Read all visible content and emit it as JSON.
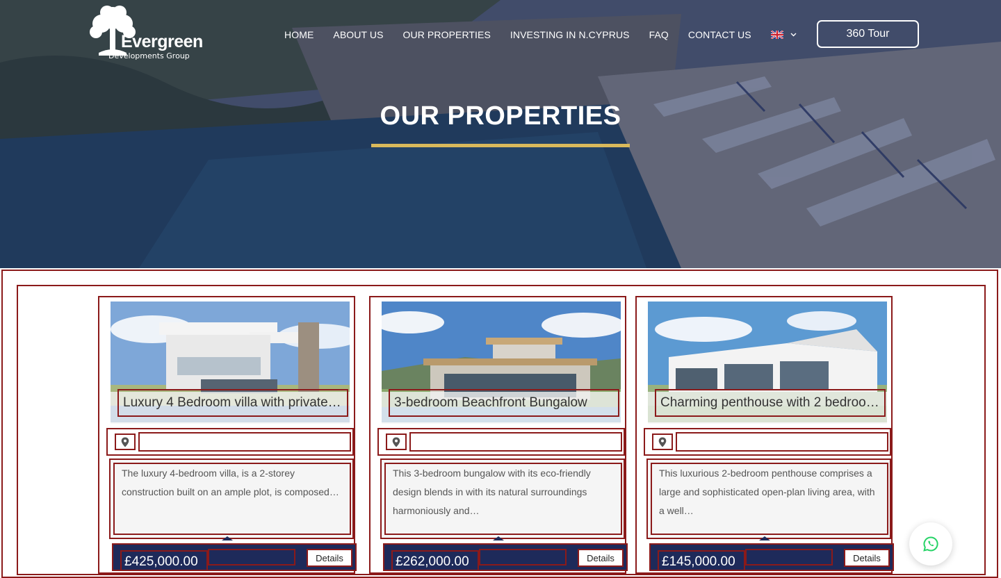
{
  "header": {
    "logo": {
      "name": "Evergreen",
      "subtitle": "Developments Group"
    },
    "nav": [
      {
        "label": "HOME"
      },
      {
        "label": "ABOUT US"
      },
      {
        "label": "OUR PROPERTIES"
      },
      {
        "label": "INVESTING IN N.CYPRUS"
      },
      {
        "label": "FAQ"
      },
      {
        "label": "CONTACT US"
      }
    ],
    "language": {
      "icon": "uk-flag-icon",
      "chevron": "chevron-down-icon"
    },
    "cta": {
      "label": "360 Tour"
    }
  },
  "hero": {
    "title": "OUR PROPERTIES",
    "underline_color": "#d9b95b"
  },
  "properties": [
    {
      "title": "Luxury 4 Bedroom villa with private…",
      "location": "",
      "description": "The luxury 4-bedroom villa, is a 2-storey construction built on an ample plot, is composed…",
      "price": "£425,000.00",
      "details_label": "Details"
    },
    {
      "title": "3-bedroom Beachfront Bungalow",
      "location": "",
      "description": "This 3-bedroom bungalow with its eco-friendly design blends in with its natural surroundings harmoniously and…",
      "price": "£262,000.00",
      "details_label": "Details"
    },
    {
      "title": "Charming penthouse with 2 bedroo…",
      "location": "",
      "description": "This luxurious 2-bedroom penthouse comprises a large and sophisticated open-plan living area, with a well…",
      "price": "£145,000.00",
      "details_label": "Details"
    }
  ],
  "colors": {
    "brand_navy": "#1e2a5a",
    "accent_gold": "#d9b95b",
    "outline_red": "#8b1a1a",
    "whatsapp_green": "#25d366"
  },
  "floating": {
    "icon": "whatsapp-icon"
  }
}
